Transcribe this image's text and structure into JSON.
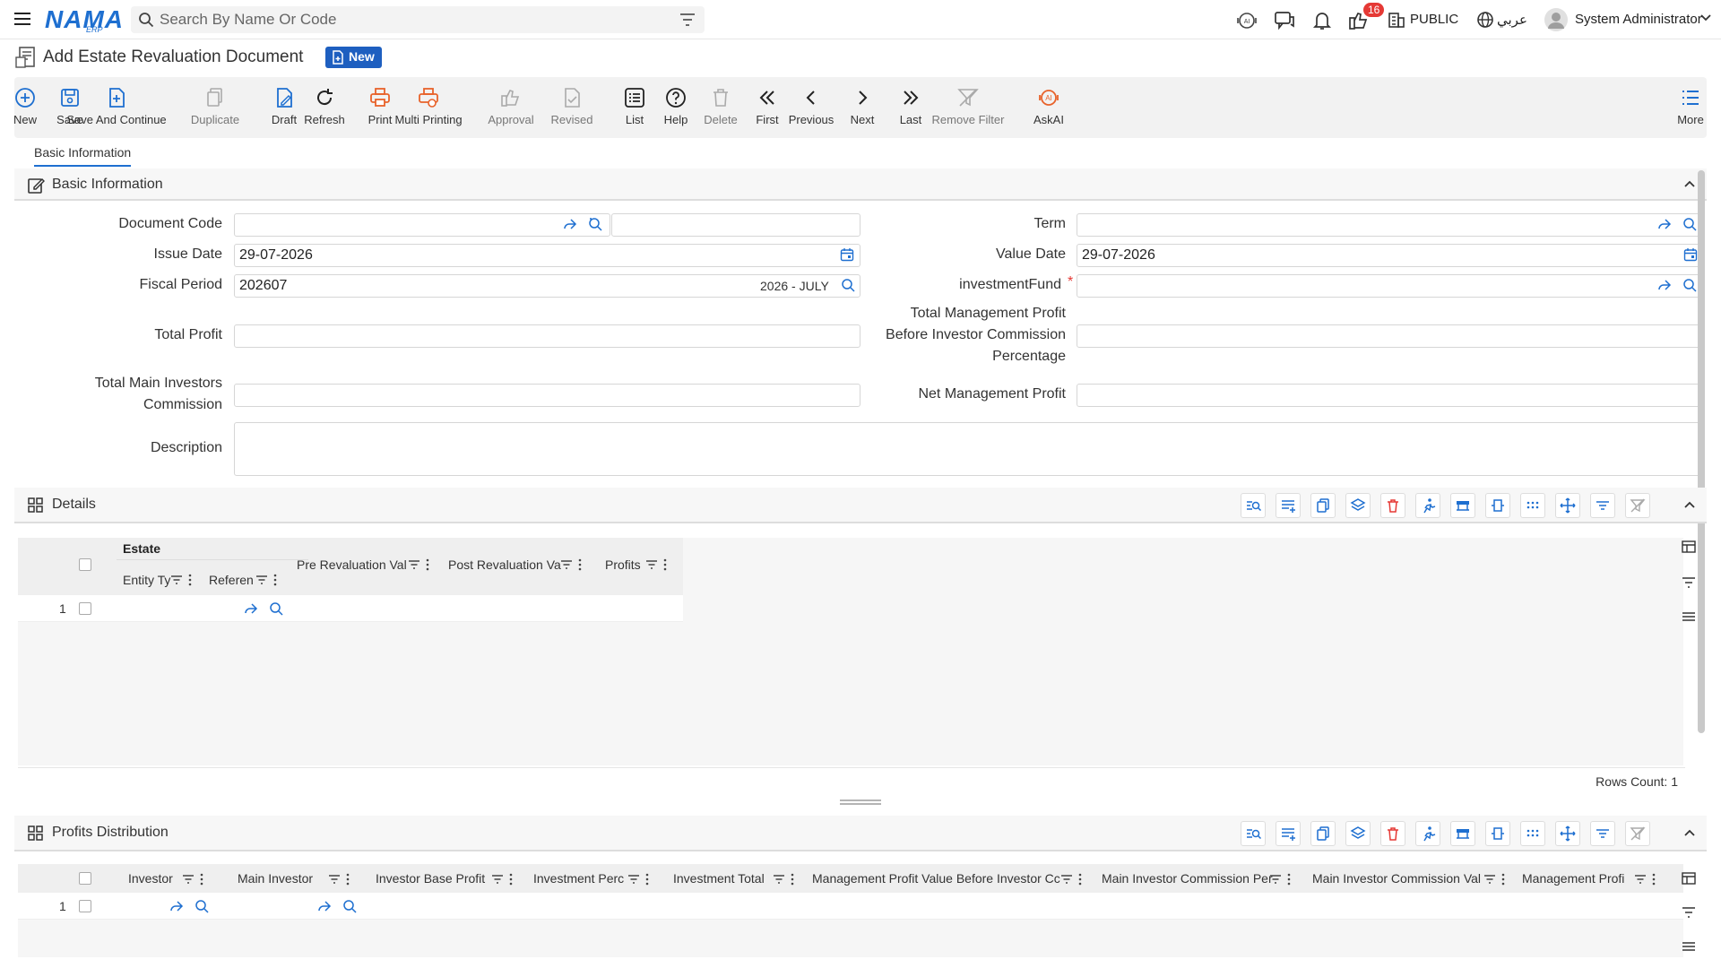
{
  "header": {
    "logo": "NAMA",
    "logo_sub": "ERP",
    "search_placeholder": "Search By Name Or Code",
    "notification_count": "16",
    "public_label": "PUBLIC",
    "language": "عربي",
    "user": "System Administrator"
  },
  "page": {
    "title": "Add Estate Revaluation Document",
    "status_badge": "New"
  },
  "toolbar": {
    "items": [
      {
        "label": "New",
        "icon": "plus-circle-icon",
        "enabled": true
      },
      {
        "label": "Save",
        "icon": "save-icon",
        "enabled": true
      },
      {
        "label": "Save And Continue",
        "icon": "save-continue-icon",
        "enabled": true
      },
      {
        "label": "Duplicate",
        "icon": "duplicate-icon",
        "enabled": false
      },
      {
        "label": "Draft",
        "icon": "draft-icon",
        "enabled": true
      },
      {
        "label": "Refresh",
        "icon": "refresh-icon",
        "enabled": true
      },
      {
        "label": "Print",
        "icon": "print-icon",
        "enabled": true
      },
      {
        "label": "Multi Printing",
        "icon": "multi-print-icon",
        "enabled": true
      },
      {
        "label": "Approval",
        "icon": "thumbs-up-icon",
        "enabled": false
      },
      {
        "label": "Revised",
        "icon": "revised-icon",
        "enabled": false
      },
      {
        "label": "List",
        "icon": "list-icon",
        "enabled": true
      },
      {
        "label": "Help",
        "icon": "help-icon",
        "enabled": true
      },
      {
        "label": "Delete",
        "icon": "trash-icon",
        "enabled": false
      },
      {
        "label": "First",
        "icon": "first-icon",
        "enabled": true
      },
      {
        "label": "Previous",
        "icon": "previous-icon",
        "enabled": true
      },
      {
        "label": "Next",
        "icon": "next-icon",
        "enabled": true
      },
      {
        "label": "Last",
        "icon": "last-icon",
        "enabled": true
      },
      {
        "label": "Remove Filter",
        "icon": "remove-filter-icon",
        "enabled": false
      },
      {
        "label": "AskAI",
        "icon": "ai-icon",
        "enabled": true
      }
    ],
    "more_label": "More"
  },
  "tabs": {
    "basic": "Basic Information"
  },
  "basic_section": {
    "title": "Basic Information",
    "document_code_label": "Document Code",
    "issue_date_label": "Issue Date",
    "issue_date": "29-07-2026",
    "fiscal_period_label": "Fiscal Period",
    "fiscal_period": "202607",
    "fiscal_period_desc": "2026 - JULY",
    "total_profit_label": "Total Profit",
    "total_main_investors_commission_label_1": "Total Main Investors",
    "total_main_investors_commission_label_2": "Commission",
    "description_label": "Description",
    "term_label": "Term",
    "value_date_label": "Value Date",
    "value_date": "29-07-2026",
    "investment_fund_label": "investmentFund",
    "required_mark": "*",
    "tmp_label_1": "Total Management Profit",
    "tmp_label_2": "Before Investor Commission",
    "tmp_label_3": "Percentage",
    "net_management_profit_label": "Net Management Profit"
  },
  "details": {
    "title": "Details",
    "group_header": "Estate",
    "columns": [
      "Entity Ty",
      "Referen",
      "Pre Revaluation Val",
      "Post Revaluation Va",
      "Profits"
    ],
    "row_number": "1",
    "rows_count": "Rows Count: 1"
  },
  "profits": {
    "title": "Profits Distribution",
    "columns": [
      "Investor",
      "Main Investor",
      "Investor Base Profit",
      "Investment Perc",
      "Investment Total",
      "Management Profit Value Before Investor Cc",
      "Main Investor Commission Per",
      "Main Investor Commission Val",
      "Management Profi"
    ],
    "row_number": "1"
  }
}
